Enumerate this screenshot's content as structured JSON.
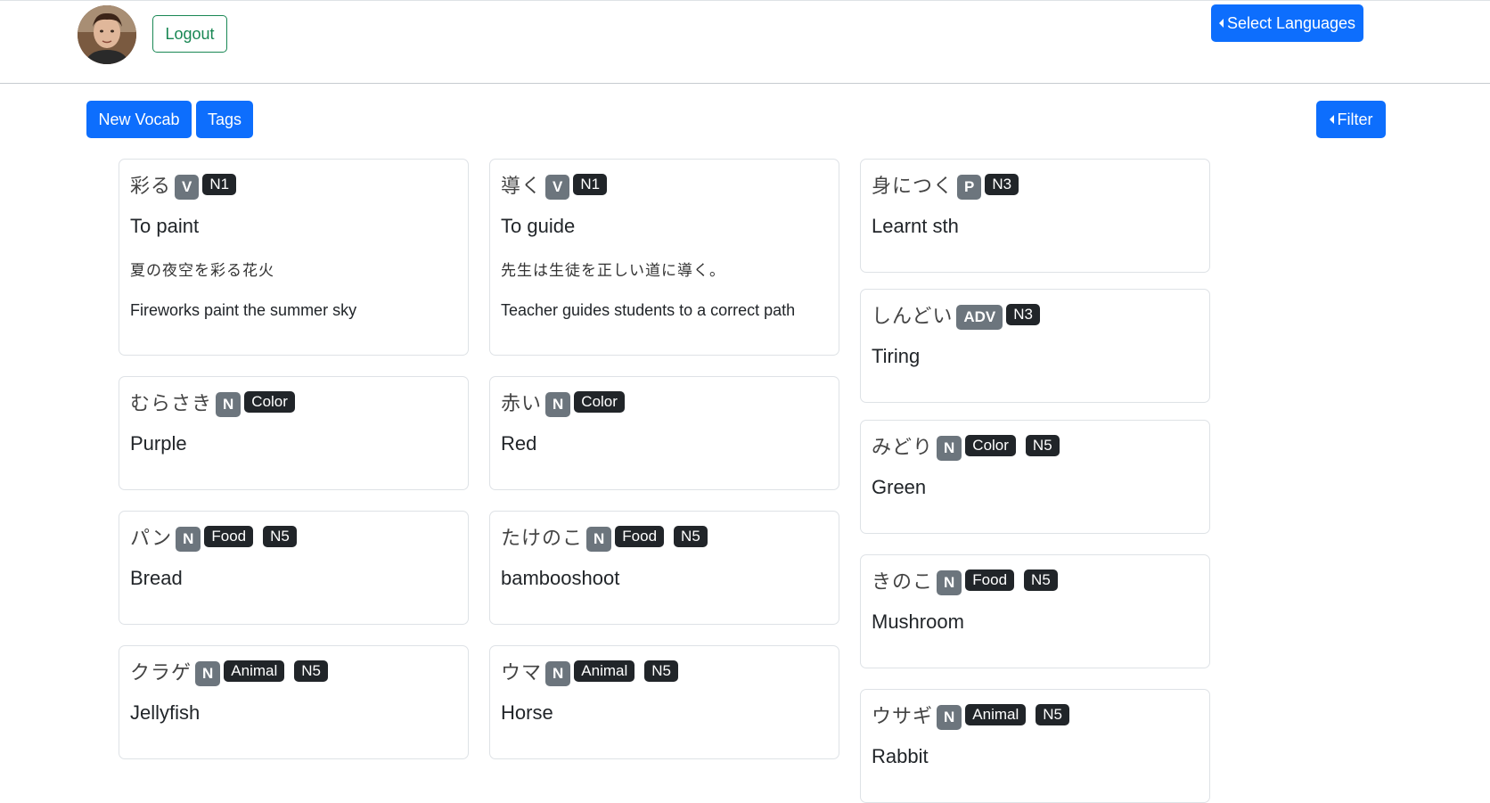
{
  "header": {
    "logout_label": "Logout",
    "select_languages_label": "Select Languages"
  },
  "toolbar": {
    "new_vocab_label": "New Vocab",
    "tags_label": "Tags",
    "filter_label": "Filter"
  },
  "colors": {
    "primary": "#0d6efd",
    "success_outline": "#198754",
    "pos_badge": "#6c757d",
    "tag_badge": "#212529"
  },
  "cards": [
    {
      "word": "彩る",
      "pos": "V",
      "tags": [
        "N1"
      ],
      "meaning": "To paint",
      "example_jp": "夏の夜空を彩る花火",
      "example_en": "Fireworks paint the summer sky"
    },
    {
      "word": "導く",
      "pos": "V",
      "tags": [
        "N1"
      ],
      "meaning": "To guide",
      "example_jp": "先生は生徒を正しい道に導く。",
      "example_en": "Teacher guides students to a correct path"
    },
    {
      "word": "身につく",
      "pos": "P",
      "tags": [
        "N3"
      ],
      "meaning": "Learnt sth"
    },
    {
      "word": "しんどい",
      "pos": "ADV",
      "tags": [
        "N3"
      ],
      "meaning": "Tiring"
    },
    {
      "word": "むらさき",
      "pos": "N",
      "tags": [
        "Color"
      ],
      "meaning": "Purple"
    },
    {
      "word": "赤い",
      "pos": "N",
      "tags": [
        "Color"
      ],
      "meaning": "Red"
    },
    {
      "word": "みどり",
      "pos": "N",
      "tags": [
        "Color",
        "N5"
      ],
      "meaning": "Green"
    },
    {
      "word": "パン",
      "pos": "N",
      "tags": [
        "Food",
        "N5"
      ],
      "meaning": "Bread"
    },
    {
      "word": "たけのこ",
      "pos": "N",
      "tags": [
        "Food",
        "N5"
      ],
      "meaning": "bambooshoot"
    },
    {
      "word": "きのこ",
      "pos": "N",
      "tags": [
        "Food",
        "N5"
      ],
      "meaning": "Mushroom"
    },
    {
      "word": "クラゲ",
      "pos": "N",
      "tags": [
        "Animal",
        "N5"
      ],
      "meaning": "Jellyfish"
    },
    {
      "word": "ウマ",
      "pos": "N",
      "tags": [
        "Animal",
        "N5"
      ],
      "meaning": "Horse"
    },
    {
      "word": "ウサギ",
      "pos": "N",
      "tags": [
        "Animal",
        "N5"
      ],
      "meaning": "Rabbit"
    }
  ]
}
